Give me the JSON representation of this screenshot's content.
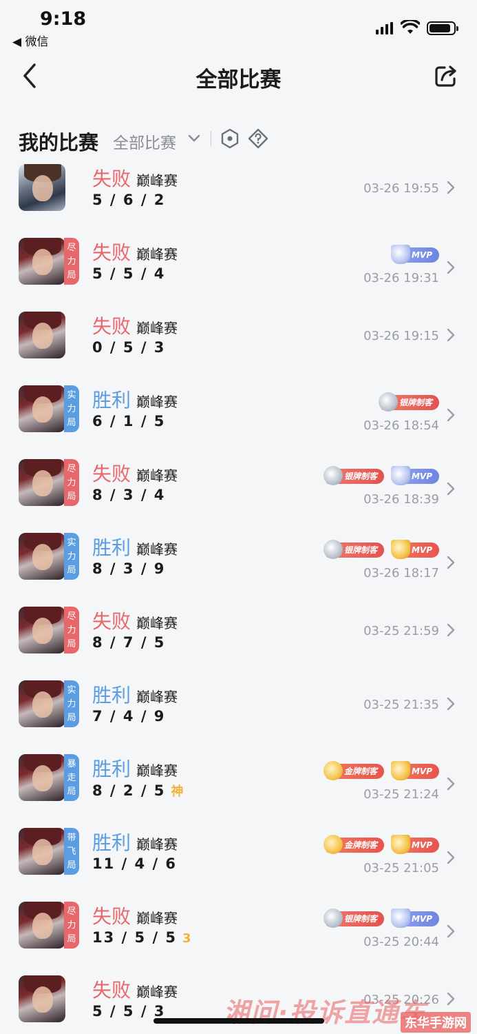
{
  "status_bar": {
    "time": "9:18",
    "back_app": "◀ 微信"
  },
  "nav": {
    "title": "全部比赛"
  },
  "filter": {
    "my_title": "我的比赛",
    "select_value": "全部比赛"
  },
  "matches": [
    {
      "result": "失败",
      "result_type": "lose",
      "mode": "巅峰赛",
      "kda": "5/6/2",
      "kda_extra": "",
      "time": "03-26 19:55",
      "tag": [],
      "tag_color": "",
      "hero": "alt",
      "badges": []
    },
    {
      "result": "失败",
      "result_type": "lose",
      "mode": "巅峰赛",
      "kda": "5/5/4",
      "kda_extra": "",
      "time": "03-26 19:31",
      "tag": [
        "尽",
        "力",
        "局"
      ],
      "tag_color": "red",
      "hero": "main",
      "badges": [
        {
          "type": "mvp-silver",
          "label": "MVP"
        }
      ]
    },
    {
      "result": "失败",
      "result_type": "lose",
      "mode": "巅峰赛",
      "kda": "0/5/3",
      "kda_extra": "",
      "time": "03-26 19:15",
      "tag": [],
      "tag_color": "",
      "hero": "main",
      "badges": []
    },
    {
      "result": "胜利",
      "result_type": "win",
      "mode": "巅峰赛",
      "kda": "6/1/5",
      "kda_extra": "",
      "time": "03-26 18:54",
      "tag": [
        "实",
        "力",
        "局"
      ],
      "tag_color": "blue",
      "hero": "main",
      "badges": [
        {
          "type": "silver",
          "label": "银牌制客"
        }
      ]
    },
    {
      "result": "失败",
      "result_type": "lose",
      "mode": "巅峰赛",
      "kda": "8/3/4",
      "kda_extra": "",
      "time": "03-26 18:39",
      "tag": [
        "尽",
        "力",
        "局"
      ],
      "tag_color": "red",
      "hero": "main",
      "badges": [
        {
          "type": "silver",
          "label": "银牌制客"
        },
        {
          "type": "mvp-silver",
          "label": "MVP"
        }
      ]
    },
    {
      "result": "胜利",
      "result_type": "win",
      "mode": "巅峰赛",
      "kda": "8/3/9",
      "kda_extra": "",
      "time": "03-26 18:17",
      "tag": [
        "实",
        "力",
        "局"
      ],
      "tag_color": "blue",
      "hero": "main",
      "badges": [
        {
          "type": "silver",
          "label": "银牌制客"
        },
        {
          "type": "mvp-gold",
          "label": "MVP"
        }
      ]
    },
    {
      "result": "失败",
      "result_type": "lose",
      "mode": "巅峰赛",
      "kda": "8/7/5",
      "kda_extra": "",
      "time": "03-25 21:59",
      "tag": [
        "尽",
        "力",
        "局"
      ],
      "tag_color": "red",
      "hero": "main",
      "badges": []
    },
    {
      "result": "胜利",
      "result_type": "win",
      "mode": "巅峰赛",
      "kda": "7/4/9",
      "kda_extra": "",
      "time": "03-25 21:35",
      "tag": [
        "实",
        "力",
        "局"
      ],
      "tag_color": "blue",
      "hero": "main",
      "badges": []
    },
    {
      "result": "胜利",
      "result_type": "win",
      "mode": "巅峰赛",
      "kda": "8/2/5",
      "kda_extra": "神",
      "time": "03-25 21:24",
      "tag": [
        "暴",
        "走",
        "局"
      ],
      "tag_color": "blue",
      "hero": "main",
      "badges": [
        {
          "type": "gold",
          "label": "金牌制客"
        },
        {
          "type": "mvp-gold",
          "label": "MVP"
        }
      ]
    },
    {
      "result": "胜利",
      "result_type": "win",
      "mode": "巅峰赛",
      "kda": "11/4/6",
      "kda_extra": "",
      "time": "03-25 21:05",
      "tag": [
        "带",
        "飞",
        "局"
      ],
      "tag_color": "blue",
      "hero": "main",
      "badges": [
        {
          "type": "gold",
          "label": "金牌制客"
        },
        {
          "type": "mvp-gold",
          "label": "MVP"
        }
      ]
    },
    {
      "result": "失败",
      "result_type": "lose",
      "mode": "巅峰赛",
      "kda": "13/5/5",
      "kda_extra": "3",
      "time": "03-25 20:44",
      "tag": [
        "尽",
        "力",
        "局"
      ],
      "tag_color": "red",
      "hero": "main",
      "badges": [
        {
          "type": "silver",
          "label": "银牌制客"
        },
        {
          "type": "mvp-silver",
          "label": "MVP"
        }
      ]
    },
    {
      "result": "失败",
      "result_type": "lose",
      "mode": "巅峰赛",
      "kda": "5/5/3",
      "kda_extra": "",
      "time": "03-25 20:26",
      "tag": [],
      "tag_color": "",
      "hero": "main",
      "badges": []
    }
  ],
  "watermark": {
    "text": "湘问·投诉直通车",
    "corner": "东华手游网"
  },
  "colors": {
    "lose": "#e8676b",
    "win": "#5a9de2",
    "muted": "#9a9da4"
  }
}
